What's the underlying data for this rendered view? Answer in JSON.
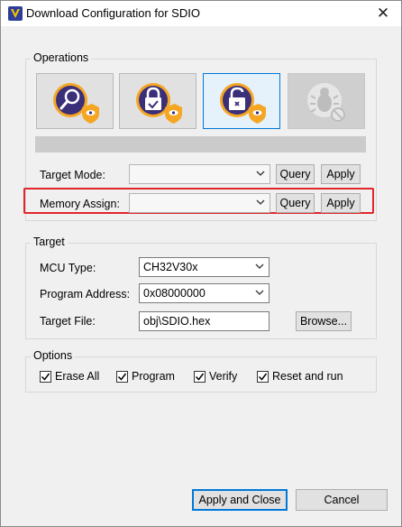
{
  "window": {
    "title": "Download Configuration for SDIO",
    "close_glyph": "✕"
  },
  "operations": {
    "group_label": "Operations",
    "buttons": [
      {
        "icon": "search-shield-icon",
        "state": "normal"
      },
      {
        "icon": "lock-check-shield-icon",
        "state": "normal"
      },
      {
        "icon": "unlock-shield-icon",
        "state": "active"
      },
      {
        "icon": "bug-disabled-icon",
        "state": "disabled"
      }
    ],
    "target_mode": {
      "label": "Target Mode:",
      "value": "",
      "query": "Query",
      "apply": "Apply"
    },
    "memory_assign": {
      "label": "Memory Assign:",
      "value": "",
      "query": "Query",
      "apply": "Apply"
    }
  },
  "target": {
    "group_label": "Target",
    "mcu_type": {
      "label": "MCU Type:",
      "value": "CH32V30x"
    },
    "program_address": {
      "label": "Program Address:",
      "value": "0x08000000"
    },
    "target_file": {
      "label": "Target File:",
      "value": "obj\\SDIO.hex",
      "browse": "Browse..."
    }
  },
  "options": {
    "group_label": "Options",
    "items": [
      {
        "label": "Erase All",
        "checked": true
      },
      {
        "label": "Program",
        "checked": true
      },
      {
        "label": "Verify",
        "checked": true
      },
      {
        "label": "Reset and run",
        "checked": true
      }
    ]
  },
  "footer": {
    "apply_close": "Apply and Close",
    "cancel": "Cancel"
  },
  "colors": {
    "accent": "#0078d7",
    "highlight": "#e0262b",
    "icon_purple": "#3b2f7a",
    "icon_orange": "#f5a623"
  }
}
